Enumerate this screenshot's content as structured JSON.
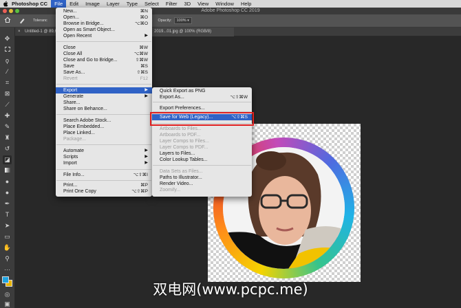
{
  "menubar": {
    "app_name": "Photoshop CC",
    "items": [
      "File",
      "Edit",
      "Image",
      "Layer",
      "Type",
      "Select",
      "Filter",
      "3D",
      "View",
      "Window",
      "Help"
    ]
  },
  "window": {
    "title": "Adobe Photoshop CC 2019"
  },
  "options_bar": {
    "tolerance_label": "Toleranc",
    "layers_label": "ers",
    "opacity_label": "Opacity:",
    "opacity_value": "100%"
  },
  "tabs": [
    {
      "label": "Untitled-1 @ 89,6..."
    },
    {
      "label": "2019...01.jpg @ 100% (RGB/8)"
    }
  ],
  "file_menu": {
    "items": [
      {
        "label": "New...",
        "shortcut": "⌘N"
      },
      {
        "label": "Open...",
        "shortcut": "⌘O"
      },
      {
        "label": "Browse in Bridge...",
        "shortcut": "⌥⌘O"
      },
      {
        "label": "Open as Smart Object..."
      },
      {
        "label": "Open Recent",
        "submenu": true
      },
      {
        "label": "Close",
        "shortcut": "⌘W"
      },
      {
        "label": "Close All",
        "shortcut": "⌥⌘W"
      },
      {
        "label": "Close and Go to Bridge...",
        "shortcut": "⇧⌘W"
      },
      {
        "label": "Save",
        "shortcut": "⌘S"
      },
      {
        "label": "Save As...",
        "shortcut": "⇧⌘S"
      },
      {
        "label": "Revert",
        "shortcut": "F12",
        "disabled": true
      },
      {
        "label": "Export",
        "submenu": true,
        "highlighted": true
      },
      {
        "label": "Generate",
        "submenu": true
      },
      {
        "label": "Share..."
      },
      {
        "label": "Share on Behance..."
      },
      {
        "label": "Search Adobe Stock..."
      },
      {
        "label": "Place Embedded..."
      },
      {
        "label": "Place Linked..."
      },
      {
        "label": "Package...",
        "disabled": true
      },
      {
        "label": "Automate",
        "submenu": true
      },
      {
        "label": "Scripts",
        "submenu": true
      },
      {
        "label": "Import",
        "submenu": true
      },
      {
        "label": "File Info...",
        "shortcut": "⌥⇧⌘I"
      },
      {
        "label": "Print...",
        "shortcut": "⌘P"
      },
      {
        "label": "Print One Copy",
        "shortcut": "⌥⇧⌘P"
      }
    ]
  },
  "export_menu": {
    "items": [
      {
        "label": "Quick Export as PNG"
      },
      {
        "label": "Export As...",
        "shortcut": "⌥⇧⌘W"
      },
      {
        "label": "Export Preferences..."
      },
      {
        "label": "Save for Web (Legacy)...",
        "shortcut": "⌥⇧⌘S",
        "highlighted": true
      },
      {
        "label": "Artboards to Files...",
        "disabled": true
      },
      {
        "label": "Artboards to PDF...",
        "disabled": true
      },
      {
        "label": "Layer Comps to Files...",
        "disabled": true
      },
      {
        "label": "Layer Comps to PDF...",
        "disabled": true
      },
      {
        "label": "Layers to Files..."
      },
      {
        "label": "Color Lookup Tables..."
      },
      {
        "label": "Data Sets as Files...",
        "disabled": true
      },
      {
        "label": "Paths to Illustrator..."
      },
      {
        "label": "Render Video..."
      },
      {
        "label": "Zoomify...",
        "disabled": true
      }
    ]
  },
  "arrow_glyph": "▶",
  "watermark": "双电网(www.pcpc.me)",
  "colors": {
    "menu_highlight": "#2f62c6",
    "callout": "#e02020",
    "canvas_bg": "#282828"
  }
}
